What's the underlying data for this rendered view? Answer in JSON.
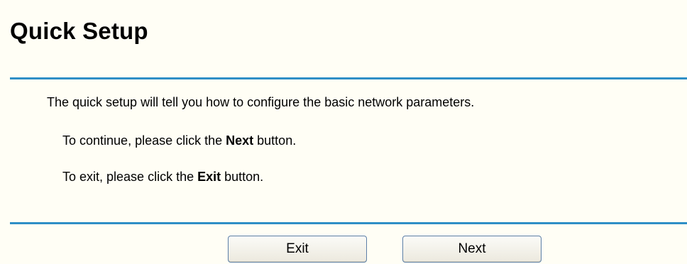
{
  "page": {
    "title": "Quick Setup"
  },
  "content": {
    "intro": "The quick setup will tell you how to configure the basic network parameters.",
    "continue_prefix": "To continue, please click the ",
    "continue_strong": "Next",
    "continue_suffix": " button.",
    "exit_prefix": "To exit, please click the ",
    "exit_strong": "Exit",
    "exit_suffix": " button."
  },
  "buttons": {
    "exit_label": "Exit",
    "next_label": "Next"
  },
  "colors": {
    "background": "#fffef5",
    "divider": "#2f8fc6",
    "button_border": "#5c7fa8"
  }
}
